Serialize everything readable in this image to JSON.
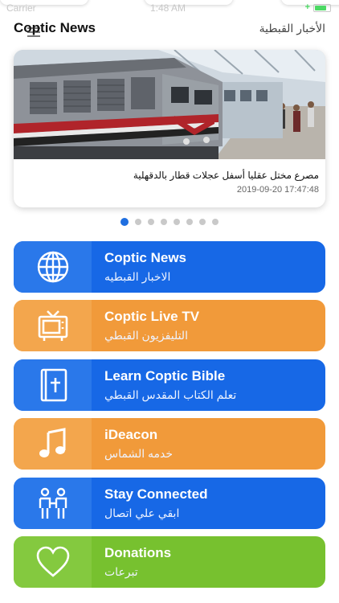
{
  "status_bar": {
    "carrier": "Carrier",
    "time": "1:48 AM"
  },
  "header": {
    "title": "Coptic News",
    "title_ar": "الأخبار القبطية"
  },
  "news": {
    "headline": "مصرع مختل عقليا أسفل عجلات قطار بالدقهلية",
    "date": "2019-09-20 17:47:48",
    "carousel": {
      "total": 8,
      "active_index": 0
    }
  },
  "menu": [
    {
      "en": "Coptic News",
      "ar": "الاخبار القبطيه",
      "icon": "globe-icon",
      "color": "#1768e6"
    },
    {
      "en": "Coptic Live TV",
      "ar": "التليفزيون القبطي",
      "icon": "tv-icon",
      "color": "#f19a3a"
    },
    {
      "en": "Learn Coptic Bible",
      "ar": "تعلم الكتاب المقدس القبطي",
      "icon": "bible-icon",
      "color": "#1768e6"
    },
    {
      "en": "iDeacon",
      "ar": "خدمه الشماس",
      "icon": "music-note-icon",
      "color": "#f19a3a"
    },
    {
      "en": "Stay Connected",
      "ar": "ابقي علي اتصال",
      "icon": "people-icon",
      "color": "#1768e6"
    },
    {
      "en": "Donations",
      "ar": "تبرعات",
      "icon": "heart-icon",
      "color": "#77c12f"
    }
  ]
}
